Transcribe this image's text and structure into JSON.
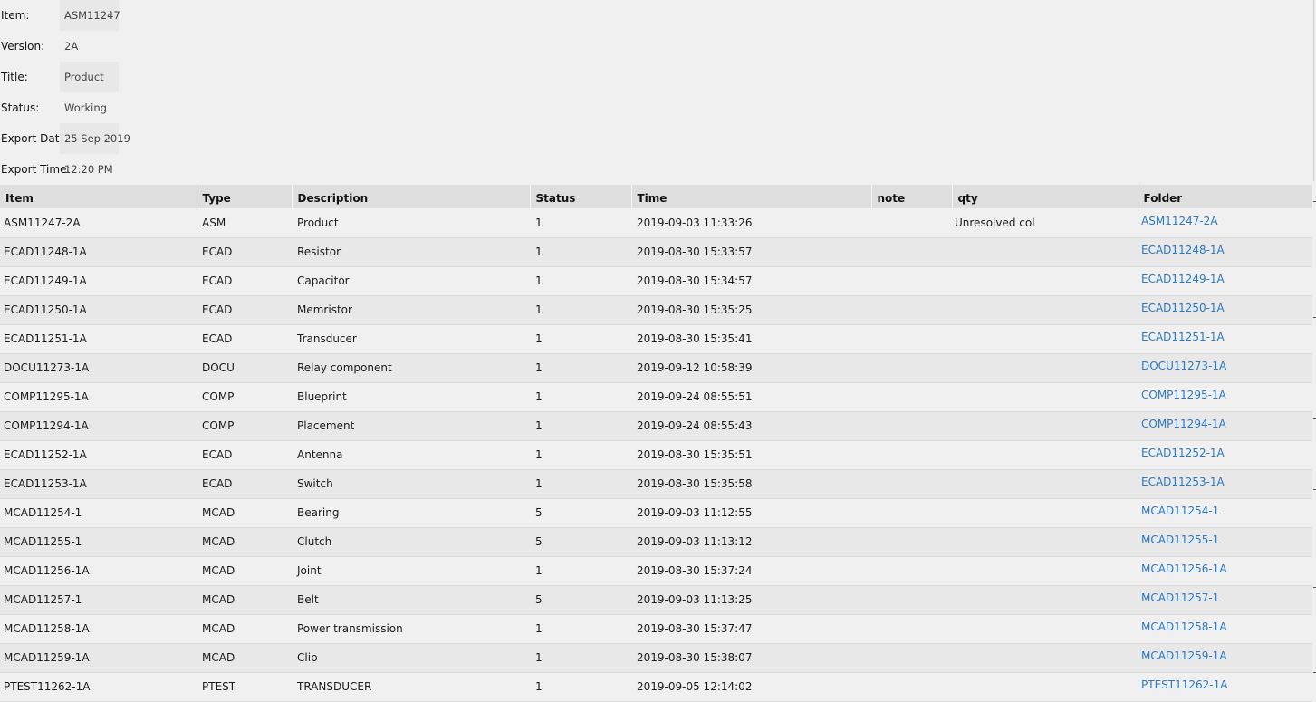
{
  "meta": {
    "item": {
      "label": "Item:",
      "value": "ASM11247"
    },
    "version": {
      "label": "Version:",
      "value": "2A"
    },
    "title": {
      "label": "Title:",
      "value": "Product"
    },
    "status": {
      "label": "Status:",
      "value": "Working"
    },
    "export_date": {
      "label": "Export Date:",
      "value": "25 Sep 2019"
    },
    "export_time": {
      "label": "Export Time:",
      "value": "12:20 PM"
    }
  },
  "table": {
    "headers": {
      "item": "Item",
      "type": "Type",
      "description": "Description",
      "status": "Status",
      "time": "Time",
      "note": "note",
      "qty": "qty",
      "folder": "Folder"
    },
    "rows": [
      {
        "item": "ASM11247-2A",
        "type": "ASM",
        "description": "Product",
        "status": "1",
        "time": "2019-09-03 11:33:26",
        "note": "",
        "qty": "Unresolved col",
        "folder": "ASM11247-2A"
      },
      {
        "item": "ECAD11248-1A",
        "type": "ECAD",
        "description": "Resistor",
        "status": "1",
        "time": "2019-08-30 15:33:57",
        "note": "",
        "qty": "",
        "folder": "ECAD11248-1A"
      },
      {
        "item": "ECAD11249-1A",
        "type": "ECAD",
        "description": "Capacitor",
        "status": "1",
        "time": "2019-08-30 15:34:57",
        "note": "",
        "qty": "",
        "folder": "ECAD11249-1A"
      },
      {
        "item": "ECAD11250-1A",
        "type": "ECAD",
        "description": "Memristor",
        "status": "1",
        "time": "2019-08-30 15:35:25",
        "note": "",
        "qty": "",
        "folder": "ECAD11250-1A"
      },
      {
        "item": "ECAD11251-1A",
        "type": "ECAD",
        "description": "Transducer",
        "status": "1",
        "time": "2019-08-30 15:35:41",
        "note": "",
        "qty": "",
        "folder": "ECAD11251-1A"
      },
      {
        "item": "DOCU11273-1A",
        "type": "DOCU",
        "description": "Relay component",
        "status": "1",
        "time": "2019-09-12 10:58:39",
        "note": "",
        "qty": "",
        "folder": "DOCU11273-1A"
      },
      {
        "item": "COMP11295-1A",
        "type": "COMP",
        "description": "Blueprint",
        "status": "1",
        "time": "2019-09-24 08:55:51",
        "note": "",
        "qty": "",
        "folder": "COMP11295-1A"
      },
      {
        "item": "COMP11294-1A",
        "type": "COMP",
        "description": "Placement",
        "status": "1",
        "time": "2019-09-24 08:55:43",
        "note": "",
        "qty": "",
        "folder": "COMP11294-1A"
      },
      {
        "item": "ECAD11252-1A",
        "type": "ECAD",
        "description": "Antenna",
        "status": "1",
        "time": "2019-08-30 15:35:51",
        "note": "",
        "qty": "",
        "folder": "ECAD11252-1A"
      },
      {
        "item": "ECAD11253-1A",
        "type": "ECAD",
        "description": "Switch",
        "status": "1",
        "time": "2019-08-30 15:35:58",
        "note": "",
        "qty": "",
        "folder": "ECAD11253-1A"
      },
      {
        "item": "MCAD11254-1",
        "type": "MCAD",
        "description": "Bearing",
        "status": "5",
        "time": "2019-09-03 11:12:55",
        "note": "",
        "qty": "",
        "folder": "MCAD11254-1"
      },
      {
        "item": "MCAD11255-1",
        "type": "MCAD",
        "description": "Clutch",
        "status": "5",
        "time": "2019-09-03 11:13:12",
        "note": "",
        "qty": "",
        "folder": "MCAD11255-1"
      },
      {
        "item": "MCAD11256-1A",
        "type": "MCAD",
        "description": "Joint",
        "status": "1",
        "time": "2019-08-30 15:37:24",
        "note": "",
        "qty": "",
        "folder": "MCAD11256-1A"
      },
      {
        "item": "MCAD11257-1",
        "type": "MCAD",
        "description": "Belt",
        "status": "5",
        "time": "2019-09-03 11:13:25",
        "note": "",
        "qty": "",
        "folder": "MCAD11257-1"
      },
      {
        "item": "MCAD11258-1A",
        "type": "MCAD",
        "description": "Power transmission",
        "status": "1",
        "time": "2019-08-30 15:37:47",
        "note": "",
        "qty": "",
        "folder": "MCAD11258-1A"
      },
      {
        "item": "MCAD11259-1A",
        "type": "MCAD",
        "description": "Clip",
        "status": "1",
        "time": "2019-08-30 15:38:07",
        "note": "",
        "qty": "",
        "folder": "MCAD11259-1A"
      },
      {
        "item": "PTEST11262-1A",
        "type": "PTEST",
        "description": "TRANSDUCER",
        "status": "1",
        "time": "2019-09-05 12:14:02",
        "note": "",
        "qty": "",
        "folder": "PTEST11262-1A"
      }
    ]
  },
  "colors": {
    "link": "#2a78c8",
    "header_bg": "#dedede",
    "row_alt_bg": "#e8e8e8",
    "page_bg": "#f0f0f0"
  }
}
